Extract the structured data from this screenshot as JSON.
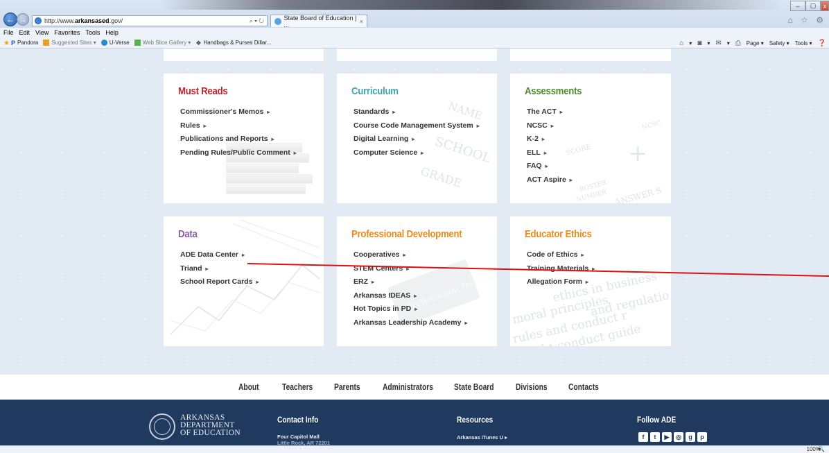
{
  "browser": {
    "url_prefix": "http://www.",
    "url_host": "arkansased",
    "url_suffix": ".gov/",
    "address_tools": "⌕ ▾ ↻",
    "tab_title": "State Board of Education | ...",
    "tab_close": "×",
    "window_controls": [
      "‒",
      "▢",
      "x"
    ],
    "right_icons": "⌂ ☆ ⚙",
    "menu": [
      "File",
      "Edit",
      "View",
      "Favorites",
      "Tools",
      "Help"
    ],
    "favorites": [
      "Pandora",
      "Suggested Sites ▾",
      "U-Verse",
      "Web Slice Gallery ▾",
      "Handbags & Purses Dillar..."
    ],
    "commands": [
      "▾",
      "▾",
      "▾",
      "Page ▾",
      "Safety ▾",
      "Tools ▾"
    ],
    "zoom": "100%",
    "zoom_arrow": "▾"
  },
  "cards": [
    {
      "title": "Must Reads",
      "links": [
        "Commissioner's Memos",
        "Rules",
        "Publications and Reports",
        "Pending Rules/Public Comment"
      ]
    },
    {
      "title": "Curriculum",
      "links": [
        "Standards",
        "Course Code Management System",
        "Digital Learning",
        "Computer Science"
      ]
    },
    {
      "title": "Assessments",
      "links": [
        "The ACT",
        "NCSC",
        "K-2",
        "ELL",
        "FAQ",
        "ACT Aspire"
      ]
    },
    {
      "title": "Data",
      "links": [
        "ADE Data Center",
        "Triand",
        "School Report Cards"
      ]
    },
    {
      "title": "Professional Development",
      "links": [
        "Cooperatives",
        "STEM Centers",
        "ERZ",
        "Arkansas IDEAS",
        "Hot Topics in PD",
        "Arkansas Leadership Academy"
      ]
    },
    {
      "title": "Educator Ethics",
      "links": [
        "Code of Ethics",
        "Training Materials",
        "Allegation Form"
      ]
    }
  ],
  "link_arrow": "▸",
  "watermarks": {
    "curriculum": [
      "NAME",
      "SCHOOL",
      "GRADE"
    ],
    "assessments": [
      "SCORE",
      "ROSTER",
      "NUMBER",
      "ANSWER S",
      "NCSC"
    ],
    "ethics": [
      "ethics in business",
      "moral principles",
      "and regulatio",
      "rules and conduct r",
      "right conduct guide"
    ],
    "pd": [
      "Professional Development"
    ]
  },
  "footer_nav": [
    "About",
    "Teachers",
    "Parents",
    "Administrators",
    "State Board",
    "Divisions",
    "Contacts"
  ],
  "footer": {
    "logo_lines": [
      "ARKANSAS",
      "DEPARTMENT",
      "OF EDUCATION"
    ],
    "contact_heading": "Contact Info",
    "contact_line1": "Four Capitol Mall",
    "contact_line2": "Little Rock, AR 72201",
    "resources_heading": "Resources",
    "resources_link": "Arkansas iTunes U",
    "follow_heading": "Follow ADE",
    "social": [
      "f",
      "t",
      "▶",
      "◎",
      "g",
      "p"
    ]
  },
  "colors": {
    "must_reads": "#c0242c",
    "curriculum": "#3fa7ad",
    "assessments": "#4d8c2b",
    "data": "#8a5ca0",
    "professional_development": "#e88a1a",
    "educator_ethics": "#e88a1a",
    "footer_bg": "#1f3a5e",
    "annotation_line": "#e01010"
  }
}
